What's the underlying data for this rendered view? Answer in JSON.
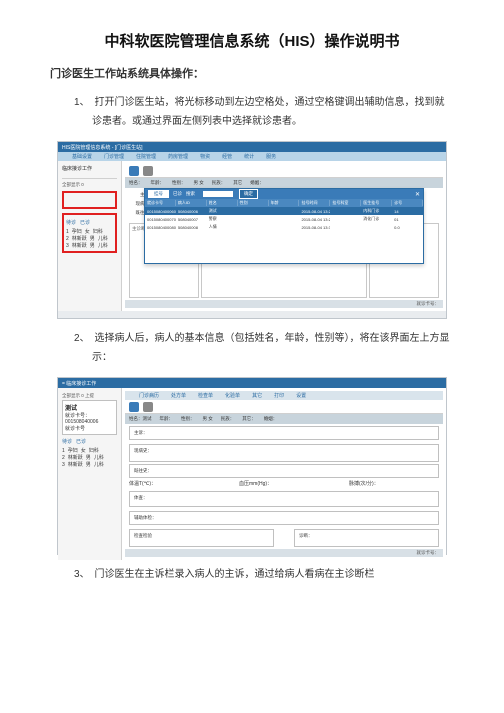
{
  "doc": {
    "title": "中科软医院管理信息系统（HIS）操作说明书",
    "subtitle": "门诊医生工作站系统具体操作：",
    "step1": "1、　打开门诊医生站，将光标移动到左边空格处，通过空格键调出辅助信息，找到就诊患者。或通过界面左侧列表中选择就诊患者。",
    "step2": "2、　选择病人后，病人的基本信息（包括姓名，年龄，性别等），将在该界面左上方显示：",
    "step3": "3、　门诊医生在主诉栏录入病人的主诉，通过给病人看病在主诊断栏"
  },
  "shot1": {
    "winTitle": "HIS医院管理信息系统 - [门诊医生站]",
    "menu": [
      "基础设置",
      "门诊管理",
      "住院管理",
      "药房管理",
      "物资",
      "经管",
      "统计",
      "服务"
    ],
    "sideTitle": "临床接诊工作",
    "sideCount": "全部显示 0",
    "tabs": [
      "待诊",
      "已诊"
    ],
    "slist": [
      {
        "n": "1",
        "name": "孕妇",
        "sex": "女",
        "dept": "妇科"
      },
      {
        "n": "2",
        "name": "林新跃",
        "sex": "男",
        "dept": "儿科"
      },
      {
        "n": "3",
        "name": "林新跃",
        "sex": "男",
        "dept": "儿科"
      }
    ],
    "info": [
      "姓名：",
      "年龄：",
      "性别：",
      "男  女",
      "民族：",
      "其它",
      "婚姻："
    ],
    "formLabels": [
      "主诉",
      "现病史",
      "既往史"
    ],
    "popup": {
      "tab1": "挂号",
      "tab2": "已诊",
      "searchLbl": "搜索",
      "okBtn": "确定",
      "cols": [
        "就诊卡号",
        "病人ID",
        "姓名",
        "性别",
        "年龄",
        "挂号时间",
        "挂号科室",
        "医生挂号",
        "诊号"
      ],
      "rows": [
        [
          "001508040006001",
          "508040006",
          "测试",
          "",
          "",
          "2015-08-04 13:20",
          "",
          "内科门诊",
          "14"
        ],
        [
          "001508040007001",
          "508040007",
          "警察",
          "",
          "",
          "2015-08-04 13:28",
          "",
          "消化门诊",
          "01"
        ],
        [
          "001508040008001",
          "508040008",
          "人情",
          "",
          "",
          "2015-08-04 13:38",
          "",
          "",
          "0.0"
        ]
      ]
    },
    "panels": [
      "主诊断",
      "",
      "",
      "诊疗卡号"
    ],
    "foot": "就诊卡号："
  },
  "shot2": {
    "winTitle": "= 临床接诊工作",
    "sideTop": "全部显示 0  上提",
    "patient": {
      "name": "测试",
      "card": "就诊卡号：",
      "cardNo": "001508040006",
      "visit": "就诊卡号"
    },
    "tabs": [
      "待诊",
      "已诊"
    ],
    "slist": [
      {
        "n": "1",
        "name": "孕妇",
        "sex": "女",
        "dept": "妇科"
      },
      {
        "n": "2",
        "name": "林新跃",
        "sex": "男",
        "dept": "儿科"
      },
      {
        "n": "3",
        "name": "林新跃",
        "sex": "男",
        "dept": "儿科"
      }
    ],
    "menu": [
      "门诊病历",
      "处方单",
      "检查单",
      "化验单",
      "其它",
      "打印",
      "设置"
    ],
    "info": [
      "姓名：测试",
      "年龄：",
      "性别：",
      "男  女",
      "民族：",
      "其它：",
      "婚姻："
    ],
    "fields": {
      "zs": "主诉：",
      "xbs": "现病史：",
      "jws": "既往史：",
      "tw": "体温T(℃)：",
      "mb": "脉搏(次/分)：",
      "xy": "血压mm(Hg)：",
      "fztj": "辅助体检：",
      "tc": "体查：",
      "jcjy": "检查检验",
      "zd": "诊断："
    },
    "foot": "就诊卡号："
  }
}
